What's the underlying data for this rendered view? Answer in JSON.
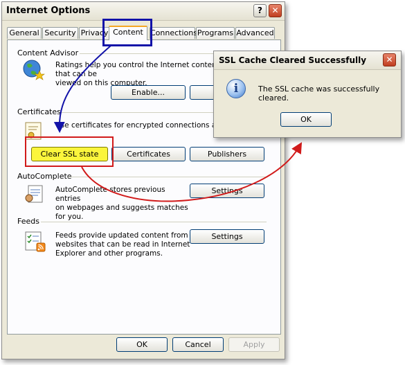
{
  "window": {
    "title": "Internet Options",
    "help_glyph": "?",
    "close_glyph": "✕"
  },
  "tabs": [
    {
      "label": "General"
    },
    {
      "label": "Security"
    },
    {
      "label": "Privacy"
    },
    {
      "label": "Content"
    },
    {
      "label": "Connections"
    },
    {
      "label": "Programs"
    },
    {
      "label": "Advanced"
    }
  ],
  "active_tab": "Content",
  "content_advisor": {
    "group": "Content Advisor",
    "description_lines": [
      "Ratings help you control the Internet content that can be",
      "viewed on this computer."
    ],
    "enable_label": "Enable..."
  },
  "certificates": {
    "group": "Certificates",
    "description": "Use certificates for encrypted connections and identification.",
    "clear_ssl_label": "Clear SSL state",
    "certificates_label": "Certificates",
    "publishers_label": "Publishers"
  },
  "autocomplete": {
    "group": "AutoComplete",
    "description_lines": [
      "AutoComplete stores previous entries",
      "on webpages and suggests matches",
      "for you."
    ],
    "settings_label": "Settings"
  },
  "feeds": {
    "group": "Feeds",
    "description_lines": [
      "Feeds provide updated content from",
      "websites that can be read in Internet",
      "Explorer and other programs."
    ],
    "settings_label": "Settings"
  },
  "footer": {
    "ok_label": "OK",
    "cancel_label": "Cancel",
    "apply_label": "Apply"
  },
  "ssl_dialog": {
    "title": "SSL Cache Cleared Successfully",
    "message": "The SSL cache was successfully cleared.",
    "ok_label": "OK",
    "info_glyph": "i",
    "close_glyph": "✕"
  },
  "annotation_colors": {
    "red": "#d11a1a",
    "blue": "#1212a8",
    "highlight": "#fbf53c"
  }
}
